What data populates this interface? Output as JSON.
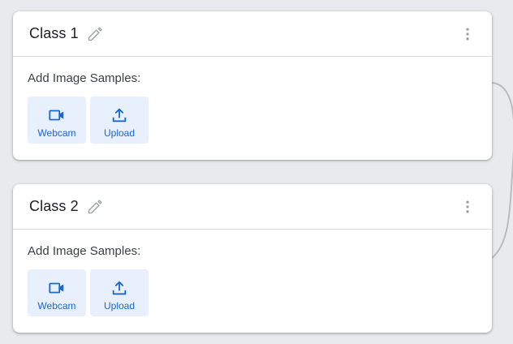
{
  "classes": [
    {
      "name": "Class 1",
      "samples_label": "Add Image Samples:",
      "buttons": [
        {
          "label": "Webcam",
          "icon": "webcam-icon"
        },
        {
          "label": "Upload",
          "icon": "upload-icon"
        }
      ]
    },
    {
      "name": "Class 2",
      "samples_label": "Add Image Samples:",
      "buttons": [
        {
          "label": "Webcam",
          "icon": "webcam-icon"
        },
        {
          "label": "Upload",
          "icon": "upload-icon"
        }
      ]
    }
  ],
  "colors": {
    "background": "#e8eaed",
    "card": "#ffffff",
    "accent": "#1967d2",
    "button_bg": "#e8f0fe",
    "icon_grey": "#9aa0a6"
  },
  "icons": {
    "edit": "pencil-icon",
    "more": "more-vert-icon"
  }
}
